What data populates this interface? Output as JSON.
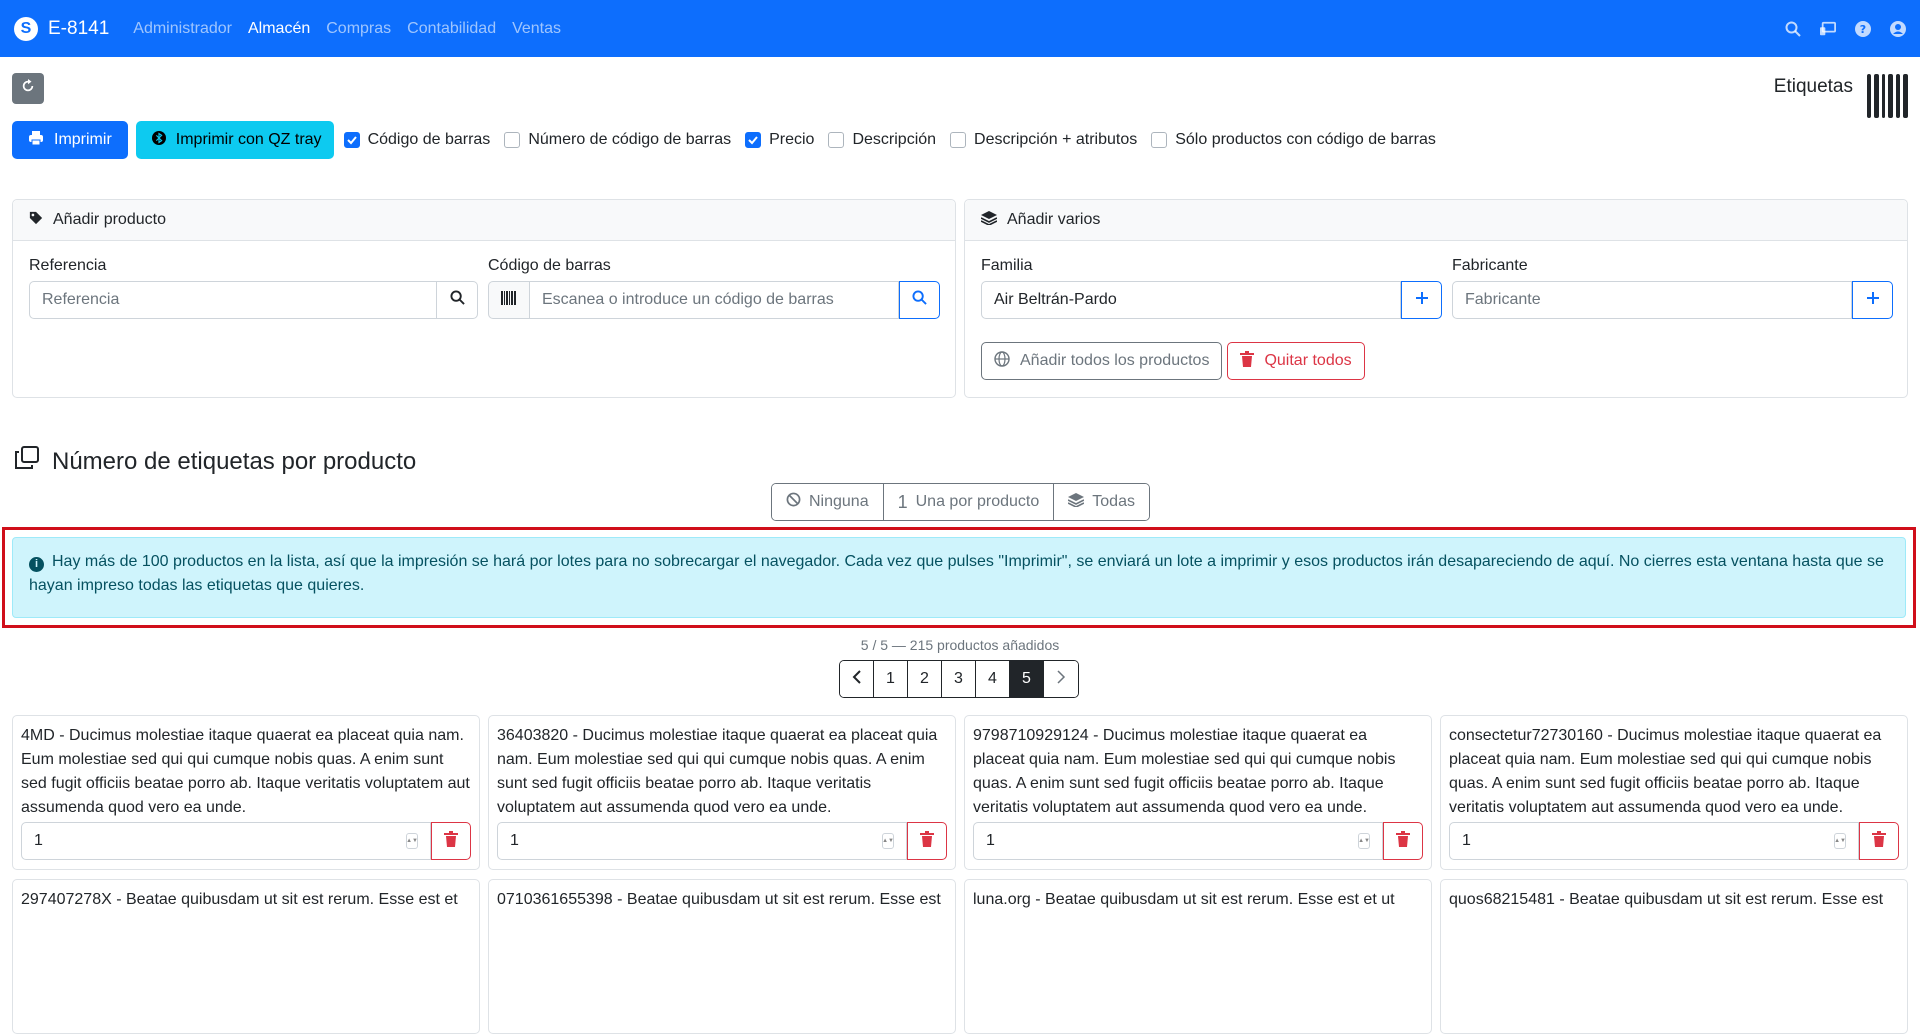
{
  "navbar": {
    "brand": "E-8141",
    "items": [
      {
        "label": "Administrador",
        "active": false
      },
      {
        "label": "Almacén",
        "active": true
      },
      {
        "label": "Compras",
        "active": false
      },
      {
        "label": "Contabilidad",
        "active": false
      },
      {
        "label": "Ventas",
        "active": false
      }
    ],
    "right_icons": [
      "search-icon",
      "monitor-icon",
      "help-icon",
      "user-icon"
    ]
  },
  "page": {
    "title": "Etiquetas",
    "title_icon": "barcode-icon"
  },
  "toolbar": {
    "refresh_icon": "refresh-icon",
    "print_label": "Imprimir",
    "qz_label": "Imprimir con QZ tray",
    "options": [
      {
        "label": "Código de barras",
        "checked": true
      },
      {
        "label": "Número de código de barras",
        "checked": false
      },
      {
        "label": "Precio",
        "checked": true
      },
      {
        "label": "Descripción",
        "checked": false
      },
      {
        "label": "Descripción + atributos",
        "checked": false
      },
      {
        "label": "Sólo productos con código de barras",
        "checked": false
      }
    ]
  },
  "add_product": {
    "header": "Añadir producto",
    "reference_label": "Referencia",
    "reference_placeholder": "Referencia",
    "barcode_label": "Código de barras",
    "barcode_placeholder": "Escanea o introduce un código de barras"
  },
  "add_many": {
    "header": "Añadir varios",
    "family_label": "Familia",
    "family_value": "Air Beltrán-Pardo",
    "maker_label": "Fabricante",
    "maker_placeholder": "Fabricante",
    "add_all_label": "Añadir todos los productos",
    "remove_all_label": "Quitar todos"
  },
  "labels_section": {
    "title": "Número de etiquetas por producto",
    "buttons": [
      {
        "label": "Ninguna",
        "icon": "ban-icon"
      },
      {
        "label": "Una por producto",
        "icon_text": "1"
      },
      {
        "label": "Todas",
        "icon": "layers-icon"
      }
    ]
  },
  "alert": {
    "text": "Hay más de 100 productos en la lista, así que la impresión se hará por lotes para no sobrecargar el navegador. Cada vez que pulses \"Imprimir\", se enviará un lote a imprimir y esos productos irán desapareciendo de aquí. No cierres esta ventana hasta que se hayan impreso todas las etiquetas que quieres."
  },
  "pagination": {
    "info": "5 / 5 — 215 productos añadidos",
    "pages": [
      "1",
      "2",
      "3",
      "4",
      "5"
    ],
    "current": "5"
  },
  "products": [
    {
      "text": "4MD - Ducimus molestiae itaque quaerat ea placeat quia nam. Eum molestiae sed qui qui cumque nobis quas. A enim sunt sed fugit officiis beatae porro ab. Itaque veritatis voluptatem aut assumenda quod vero ea unde.",
      "qty": "1"
    },
    {
      "text": "36403820 - Ducimus molestiae itaque quaerat ea placeat quia nam. Eum molestiae sed qui qui cumque nobis quas. A enim sunt sed fugit officiis beatae porro ab. Itaque veritatis voluptatem aut assumenda quod vero ea unde.",
      "qty": "1"
    },
    {
      "text": "9798710929124 - Ducimus molestiae itaque quaerat ea placeat quia nam. Eum molestiae sed qui qui cumque nobis quas. A enim sunt sed fugit officiis beatae porro ab. Itaque veritatis voluptatem aut assumenda quod vero ea unde.",
      "qty": "1"
    },
    {
      "text": "consectetur72730160 - Ducimus molestiae itaque quaerat ea placeat quia nam. Eum molestiae sed qui qui cumque nobis quas. A enim sunt sed fugit officiis beatae porro ab. Itaque veritatis voluptatem aut assumenda quod vero ea unde.",
      "qty": "1"
    },
    {
      "text": "297407278X - Beatae quibusdam ut sit est rerum. Esse est et",
      "qty": ""
    },
    {
      "text": "0710361655398 - Beatae quibusdam ut sit est rerum. Esse est",
      "qty": ""
    },
    {
      "text": "luna.org - Beatae quibusdam ut sit est rerum. Esse est et ut",
      "qty": ""
    },
    {
      "text": "quos68215481 - Beatae quibusdam ut sit est rerum. Esse est",
      "qty": ""
    }
  ],
  "colors": {
    "primary": "#0d6efd",
    "info": "#0dcaf0",
    "danger": "#dc3545",
    "alert_bg": "#cff4fc",
    "highlight_border": "#d00f1a"
  }
}
